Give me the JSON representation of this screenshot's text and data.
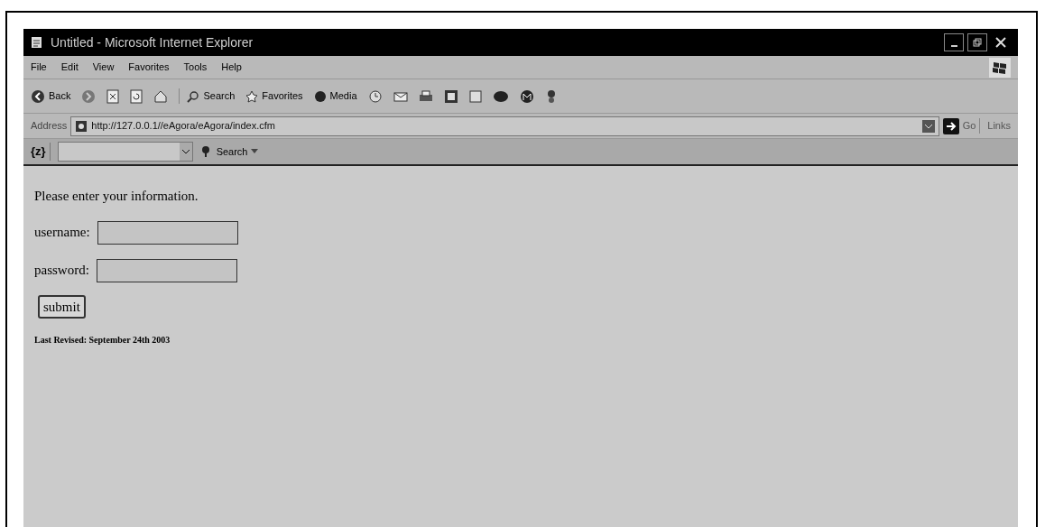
{
  "window": {
    "title": "Untitled - Microsoft Internet Explorer"
  },
  "menu": [
    "File",
    "Edit",
    "View",
    "Favorites",
    "Tools",
    "Help"
  ],
  "toolbar": {
    "back": "Back",
    "search": "Search",
    "favorites": "Favorites",
    "media": "Media"
  },
  "address_bar": {
    "label": "Address",
    "url": "http://127.0.0.1//eAgora/eAgora/index.cfm",
    "go": "Go",
    "links": "Links"
  },
  "search_bar": {
    "logo": "{z}",
    "button": "Search"
  },
  "page": {
    "heading": "Please enter your information.",
    "fields": [
      {
        "label": "username:"
      },
      {
        "label": "password:"
      }
    ],
    "submit": "submit",
    "footer": "Last Revised: September 24th 2003"
  }
}
